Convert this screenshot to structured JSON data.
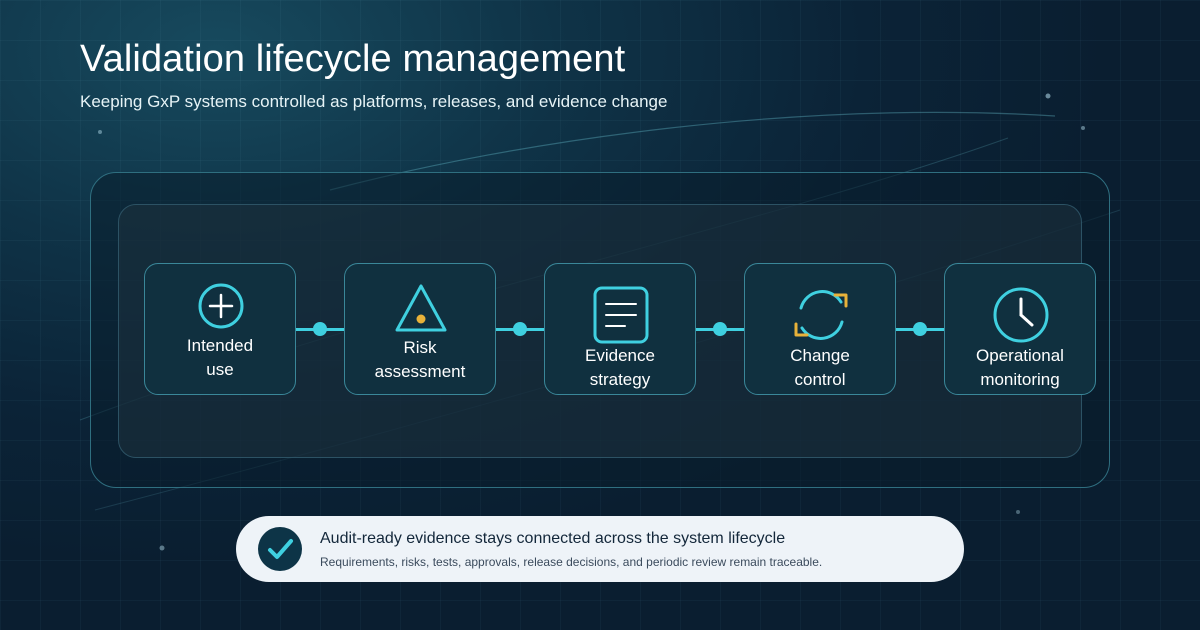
{
  "header": {
    "title": "Validation lifecycle management",
    "subtitle": "Keeping GxP systems controlled as platforms, releases, and evidence change"
  },
  "colors": {
    "background": "#0b2337",
    "accent_cyan": "#3fd0e0",
    "accent_amber": "#e8b23a",
    "step_fill": "#10303f",
    "callout_fill": "#eef3f8"
  },
  "steps": [
    {
      "icon": "plus-circle-icon",
      "line1": "Intended",
      "line2": "use"
    },
    {
      "icon": "warning-triangle-icon",
      "line1": "Risk",
      "line2": "assessment"
    },
    {
      "icon": "document-icon",
      "line1": "Evidence",
      "line2": "strategy"
    },
    {
      "icon": "refresh-cycle-icon",
      "line1": "Change",
      "line2": "control"
    },
    {
      "icon": "clock-icon",
      "line1": "Operational",
      "line2": "monitoring"
    }
  ],
  "callout": {
    "icon": "checkmark-icon",
    "title": "Audit-ready evidence stays connected across the system lifecycle",
    "text": "Requirements, risks, tests, approvals, release decisions, and periodic review remain traceable."
  }
}
